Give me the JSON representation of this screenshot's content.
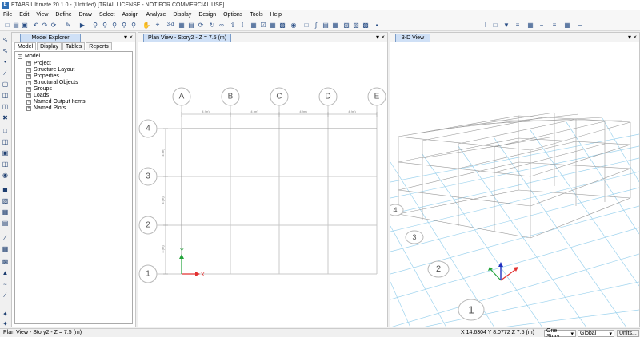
{
  "window": {
    "title": "ETABS Ultimate 20.1.0 - (Untitled)  [TRIAL LICENSE - NOT FOR COMMERCIAL USE]",
    "app_icon": "E"
  },
  "menu": [
    "File",
    "Edit",
    "View",
    "Define",
    "Draw",
    "Select",
    "Assign",
    "Analyze",
    "Display",
    "Design",
    "Options",
    "Tools",
    "Help"
  ],
  "toolbar": {
    "view_3d_label": "3-d"
  },
  "explorer": {
    "title": "Model Explorer",
    "tabs": [
      "Model",
      "Display",
      "Tables",
      "Reports"
    ],
    "tree_root": "Model",
    "tree_items": [
      "Project",
      "Structure Layout",
      "Properties",
      "Structural Objects",
      "Groups",
      "Loads",
      "Named Output Items",
      "Named Plots"
    ]
  },
  "plan_view": {
    "tab_title": "Plan View - Story2 - Z = 7.5 (m)",
    "grid_x_labels": [
      "A",
      "B",
      "C",
      "D",
      "E"
    ],
    "grid_y_labels": [
      "4",
      "3",
      "2",
      "1"
    ],
    "x_spacing_label": "4 (m)",
    "y_spacing_label": "4 (m)"
  },
  "view_3d": {
    "tab_title": "3-D View",
    "grid_labels": [
      "4",
      "3",
      "2",
      "1"
    ]
  },
  "statusbar": {
    "left": "Plan View - Story2 - Z = 7.5 (m)",
    "coords": "X 14.6304  Y 8.0772  Z 7.5 (m)",
    "story_mode": "One Story",
    "coord_system": "Global",
    "units": "Units..."
  },
  "colors": {
    "accent": "#2f6fb4",
    "grid_3d": "#9ed3ee",
    "axis_x": "#e23030",
    "axis_y": "#22a33a",
    "axis_z": "#2030c0"
  }
}
